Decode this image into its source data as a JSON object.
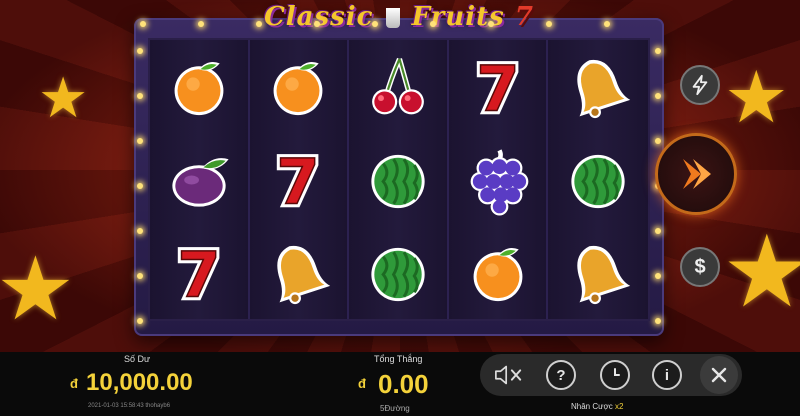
{
  "game": {
    "title_main": "Classic",
    "title_cup": "",
    "title_fruits": "Fruits",
    "title_seven": "7"
  },
  "reels": [
    [
      "orange",
      "orange",
      "cherry",
      "seven",
      "bell"
    ],
    [
      "plum",
      "seven",
      "watermelon",
      "grapes",
      "watermelon"
    ],
    [
      "seven",
      "bell",
      "watermelon",
      "orange",
      "bell"
    ]
  ],
  "side_buttons": {
    "turbo_icon": "lightning-icon",
    "spin_icon": "spin-arrow-icon",
    "bet_icon": "dollar-icon",
    "bet_glyph": "$"
  },
  "footer": {
    "balance_label": "Số Dư",
    "currency_symbol": "đ",
    "balance_value": "10,000.00",
    "datetime": "2021-01-03 15:58:43   thohayb6",
    "win_label": "Tổng Thắng",
    "win_value": "0.00",
    "lines_label": "5Đường",
    "multiplier_label": "Nhân Cược",
    "multiplier_value": "x2"
  },
  "controls": {
    "help_glyph": "?",
    "info_glyph": "i"
  },
  "colors": {
    "accent_gold": "#f4d23a",
    "panel_purple": "#2e2152",
    "spin_orange": "#e8641a"
  }
}
